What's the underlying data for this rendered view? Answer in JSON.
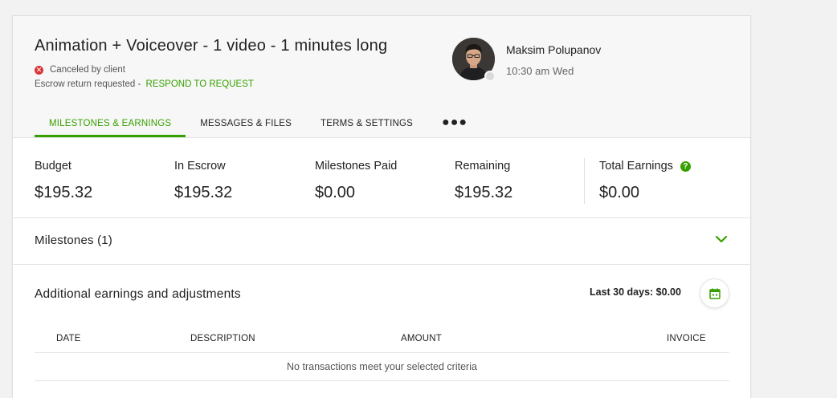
{
  "contract": {
    "title": "Animation + Voiceover - 1 video - 1 minutes long",
    "status_text": "Canceled by client",
    "escrow_text": "Escrow return requested -",
    "respond_link": "RESPOND TO REQUEST"
  },
  "user": {
    "name": "Maksim Polupanov",
    "time": "10:30 am Wed"
  },
  "tabs": [
    {
      "label": "MILESTONES & EARNINGS",
      "active": true
    },
    {
      "label": "MESSAGES & FILES",
      "active": false
    },
    {
      "label": "TERMS & SETTINGS",
      "active": false
    },
    {
      "label": "●●●",
      "active": false
    }
  ],
  "stats": [
    {
      "label": "Budget",
      "value": "$195.32"
    },
    {
      "label": "In Escrow",
      "value": "$195.32"
    },
    {
      "label": "Milestones Paid",
      "value": "$0.00"
    },
    {
      "label": "Remaining",
      "value": "$195.32"
    },
    {
      "label": "Total Earnings",
      "value": "$0.00"
    }
  ],
  "milestones": {
    "title": "Milestones (1)"
  },
  "adjustments": {
    "title": "Additional earnings and adjustments",
    "last30": "Last 30 days: $0.00",
    "columns": [
      "DATE",
      "DESCRIPTION",
      "AMOUNT",
      "INVOICE"
    ],
    "empty_message": "No transactions meet your selected criteria"
  },
  "colors": {
    "accent": "#37a000",
    "error": "#d93636"
  }
}
